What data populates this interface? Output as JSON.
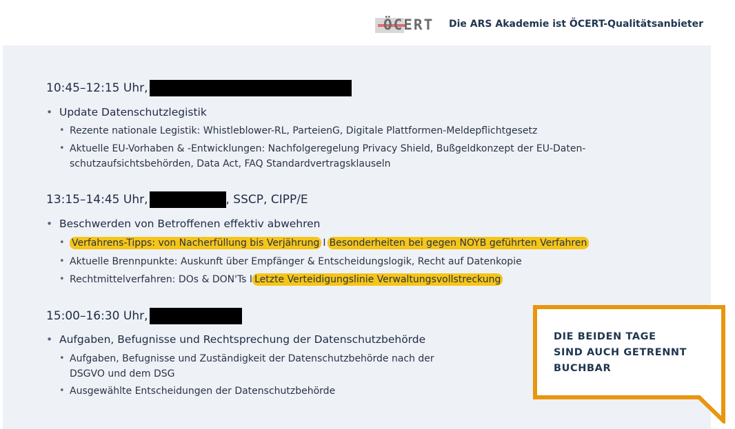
{
  "header": {
    "logo_text": "ÖCERT",
    "provider_text": "Die ARS Akademie ist ÖCERT-Qualitätsanbieter"
  },
  "sessions": [
    {
      "time": "10:45–12:15 Uhr,",
      "suffix": "",
      "topic": "Update Datenschutzlegistik",
      "items": [
        [
          "Rezente nationale Legistik: Whistleblower-RL, ParteienG, Digitale Plattformen-Meldepflichtgesetz"
        ],
        [
          "Aktuelle EU-Vorhaben & -Entwicklungen: Nachfolgeregelung Privacy Shield, Bußgeldkonzept der EU-Daten-",
          "schutzaufsichtsbehörden, Data Act, FAQ Standardvertragsklauseln"
        ]
      ]
    },
    {
      "time": "13:15–14:45 Uhr,",
      "suffix": ", SSCP, CIPP/E",
      "topic": "Beschwerden von Betroffenen effektiv abwehren",
      "items": [
        {
          "hl1": "Verfahrens-Tipps: von Nacherfüllung bis Verjährung",
          "sep": "I",
          "hl2": "Besonderheiten bei gegen NOYB geführten Verfahren"
        },
        [
          "Aktuelle Brennpunkte: Auskunft über Empfänger & Entscheidungslogik, Recht auf Datenkopie"
        ],
        {
          "text": "Rechtmittelverfahren: DOs & DON'Ts I",
          "hl": "Letzte Verteidigungslinie Verwaltungsvollstreckung"
        }
      ]
    },
    {
      "time": "15:00–16:30 Uhr,",
      "suffix": "",
      "topic": "Aufgaben, Befugnisse und Rechtsprechung der Datenschutzbehörde",
      "items": [
        [
          "Aufgaben, Befugnisse und Zuständigkeit der Datenschutzbehörde nach der",
          "DSGVO und dem DSG"
        ],
        [
          "Ausgewählte Entscheidungen der Datenschutzbehörde"
        ]
      ]
    }
  ],
  "callout": {
    "line1": "DIE BEIDEN TAGE",
    "line2": "SIND AUCH GETRENNT",
    "line3": "BUCHBAR"
  },
  "colors": {
    "highlight": "#f5c518",
    "callout_border": "#e8960f",
    "panel_bg": "#eef1f6",
    "text": "#1f2a44"
  }
}
